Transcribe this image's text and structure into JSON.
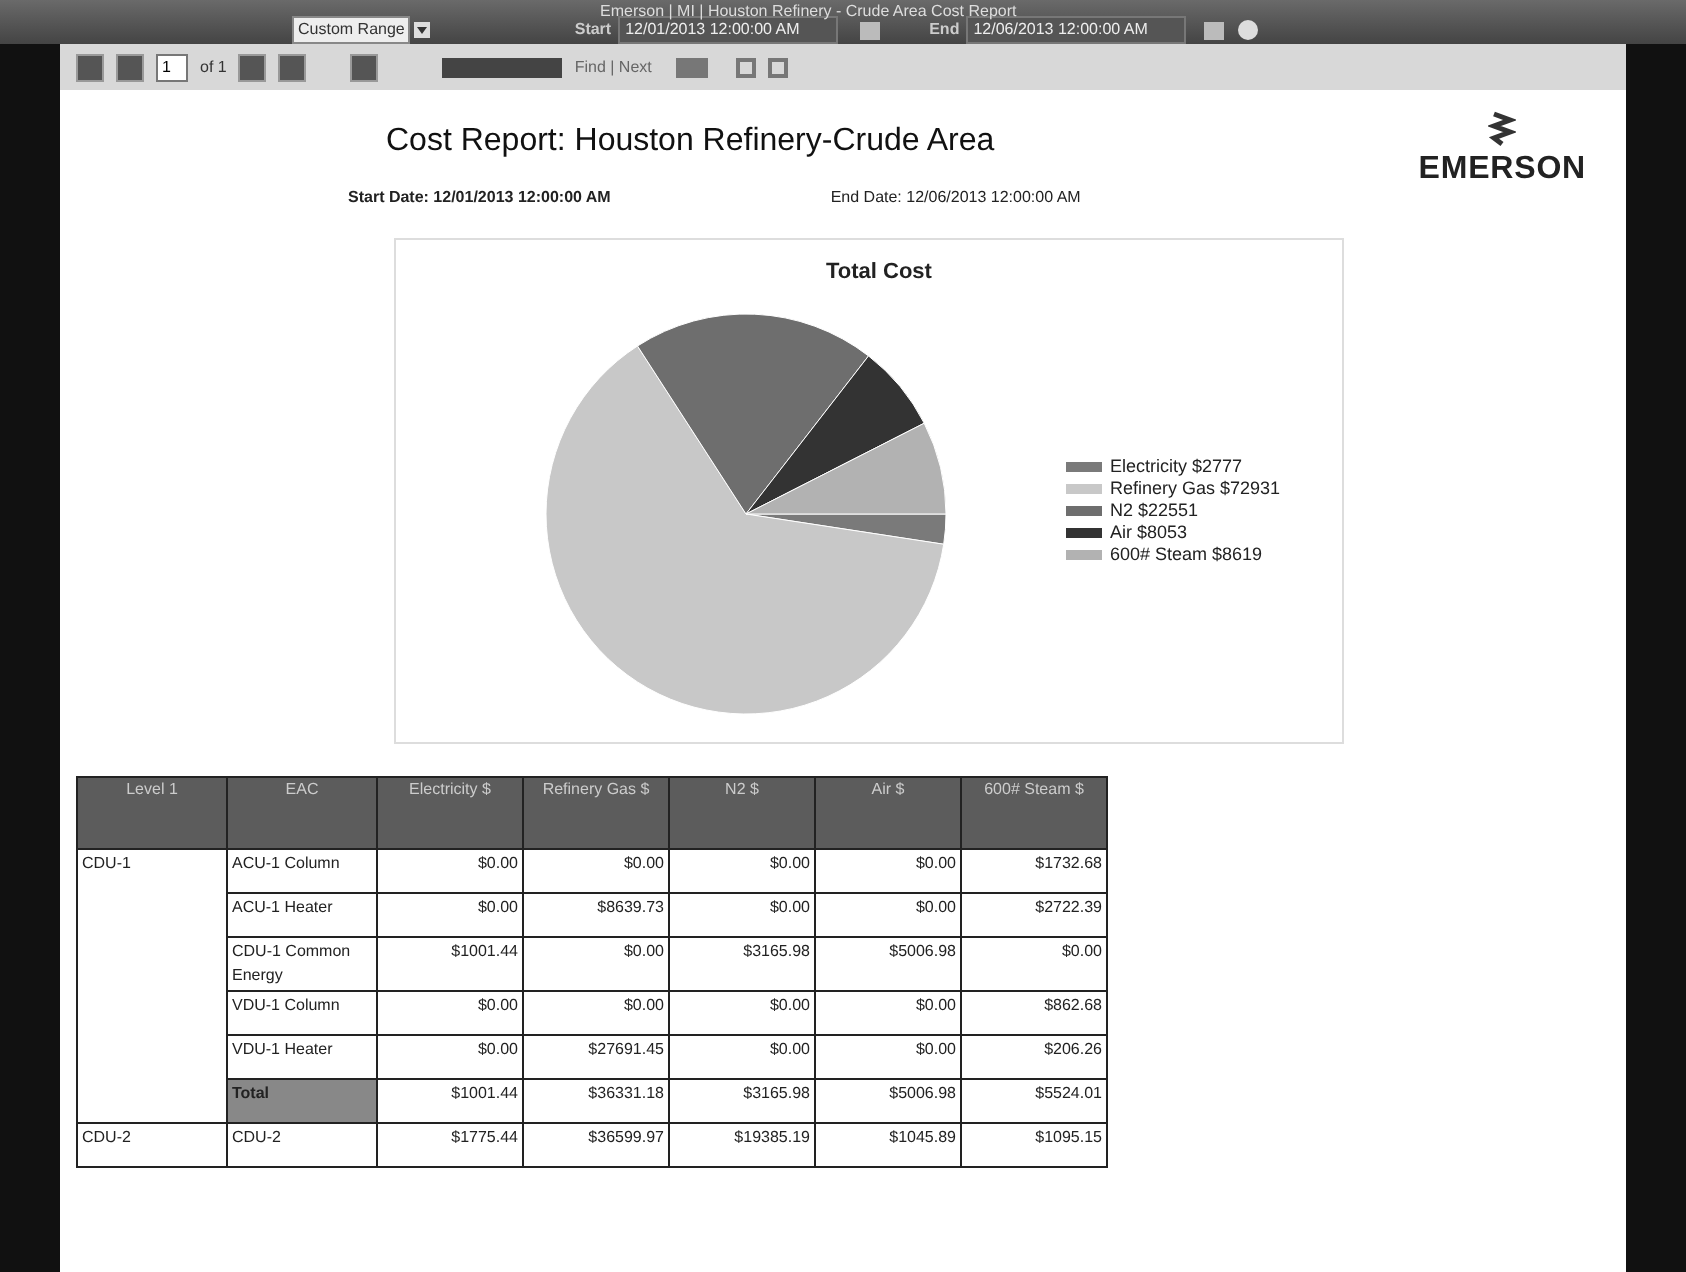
{
  "window": {
    "title": "Emerson | MI | Houston Refinery - Crude Area Cost Report"
  },
  "range": {
    "value": "Custom Range"
  },
  "start": {
    "label": "Start",
    "value": "12/01/2013 12:00:00 AM"
  },
  "end": {
    "label": "End",
    "value": "12/06/2013 12:00:00 AM"
  },
  "toolbar": {
    "page": "1",
    "of": "of 1",
    "find": {
      "placeholder": "Find | Next"
    }
  },
  "report": {
    "title": "Cost Report: Houston Refinery-Crude Area",
    "logo": "EMERSON",
    "start_date": "Start Date: 12/01/2013 12:00:00 AM",
    "end_date": "End Date: 12/06/2013 12:00:00 AM",
    "chart_data": {
      "type": "pie",
      "title": "Total Cost",
      "categories": [
        "Electricity $2777",
        "Refinery Gas $72931",
        "N2 $22551",
        "Air $8053",
        "600# Steam $8619"
      ],
      "values": [
        2777,
        72931,
        22551,
        8053,
        8619
      ],
      "legend": "right"
    },
    "slices": [
      {
        "color": "#7a7a7a"
      },
      {
        "color": "#c8c8c8"
      },
      {
        "color": "#6e6e6e"
      },
      {
        "color": "#333333"
      },
      {
        "color": "#b2b2b2"
      }
    ]
  },
  "table": {
    "columns": [
      "Level 1",
      "EAC",
      "Electricity $",
      "Refinery Gas $",
      "N2 $",
      "Air $",
      "600# Steam $"
    ],
    "groups": [
      {
        "level1": "CDU-1",
        "rows": [
          {
            "eac": "ACU-1 Column",
            "kind": "item",
            "values": [
              "$0.00",
              "$0.00",
              "$0.00",
              "$0.00",
              "$1732.68"
            ]
          },
          {
            "eac": "ACU-1 Heater",
            "kind": "item",
            "values": [
              "$0.00",
              "$8639.73",
              "$0.00",
              "$0.00",
              "$2722.39"
            ]
          },
          {
            "eac": "CDU-1 Common Energy",
            "kind": "item",
            "values": [
              "$1001.44",
              "$0.00",
              "$3165.98",
              "$5006.98",
              "$0.00"
            ]
          },
          {
            "eac": "VDU-1 Column",
            "kind": "item",
            "values": [
              "$0.00",
              "$0.00",
              "$0.00",
              "$0.00",
              "$862.68"
            ]
          },
          {
            "eac": "VDU-1 Heater",
            "kind": "item",
            "values": [
              "$0.00",
              "$27691.45",
              "$0.00",
              "$0.00",
              "$206.26"
            ]
          },
          {
            "eac": "Total",
            "kind": "total",
            "values": [
              "$1001.44",
              "$36331.18",
              "$3165.98",
              "$5006.98",
              "$5524.01"
            ]
          }
        ]
      },
      {
        "level1": "CDU-2",
        "rows": [
          {
            "eac": "CDU-2",
            "kind": "item",
            "values": [
              "$1775.44",
              "$36599.97",
              "$19385.19",
              "$1045.89",
              "$1095.15"
            ]
          }
        ]
      }
    ]
  }
}
